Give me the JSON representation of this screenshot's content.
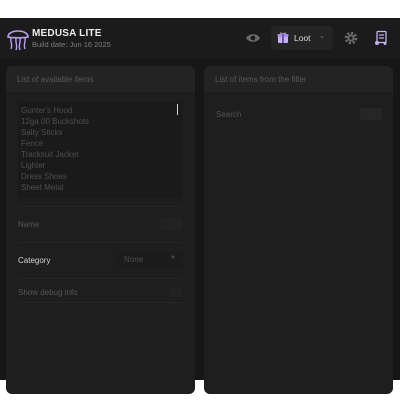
{
  "app": {
    "title": "MEDUSA LITE",
    "build_date": "Build date: Jun 16 2025",
    "logo_icon": "jellyfish-icon",
    "accent_color": "#b7a0f0"
  },
  "header": {
    "visibility_icon": "eye-icon",
    "loot_button": {
      "label": "Loot",
      "icon": "loot-box-icon",
      "chevron": "chevron-down-icon"
    },
    "settings_icon": "gear-icon",
    "cart_icon": "cart-icon"
  },
  "left_panel": {
    "title": "List of available items",
    "items": [
      "Gunter's Hood",
      "12ga 00 Buckshots",
      "Salty Sticks",
      "Fence",
      "Tracksuit Jacket",
      "Lighter",
      "Dress Shoes",
      "Sheet Metal"
    ],
    "name_label": "Name",
    "category_label": "Category",
    "category_value": "None",
    "debug_label": "Show debug info"
  },
  "right_panel": {
    "title": "List of items from the filter",
    "search_label": "Search"
  }
}
